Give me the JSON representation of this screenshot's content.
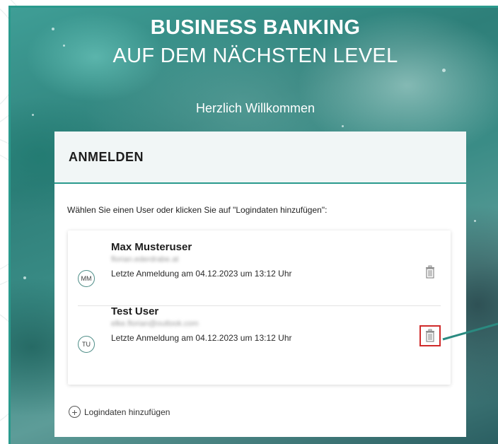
{
  "hero": {
    "title_bold": "BUSINESS BANKING",
    "title_light": "AUF DEM NÄCHSTEN LEVEL",
    "welcome": "Herzlich Willkommen"
  },
  "login_card": {
    "title": "ANMELDEN",
    "instructions": "Wählen Sie einen User oder klicken Sie auf \"Logindaten hinzufügen\":",
    "users": [
      {
        "initials": "MM",
        "name": "Max Musteruser",
        "email": "florian.ederdrabe.at",
        "last_login": "Letzte Anmeldung am 04.12.2023 um 13:12 Uhr",
        "delete_highlighted": false
      },
      {
        "initials": "TU",
        "name": "Test User",
        "email": "elke.florian@outlook.com",
        "last_login": "Letzte Anmeldung am 04.12.2023 um 13:12 Uhr",
        "delete_highlighted": true
      }
    ],
    "add_login_label": "Logindaten hinzufügen"
  },
  "colors": {
    "accent": "#2a9a8d",
    "highlight_box": "#d02a2a",
    "callout_line": "#2a8a80"
  }
}
